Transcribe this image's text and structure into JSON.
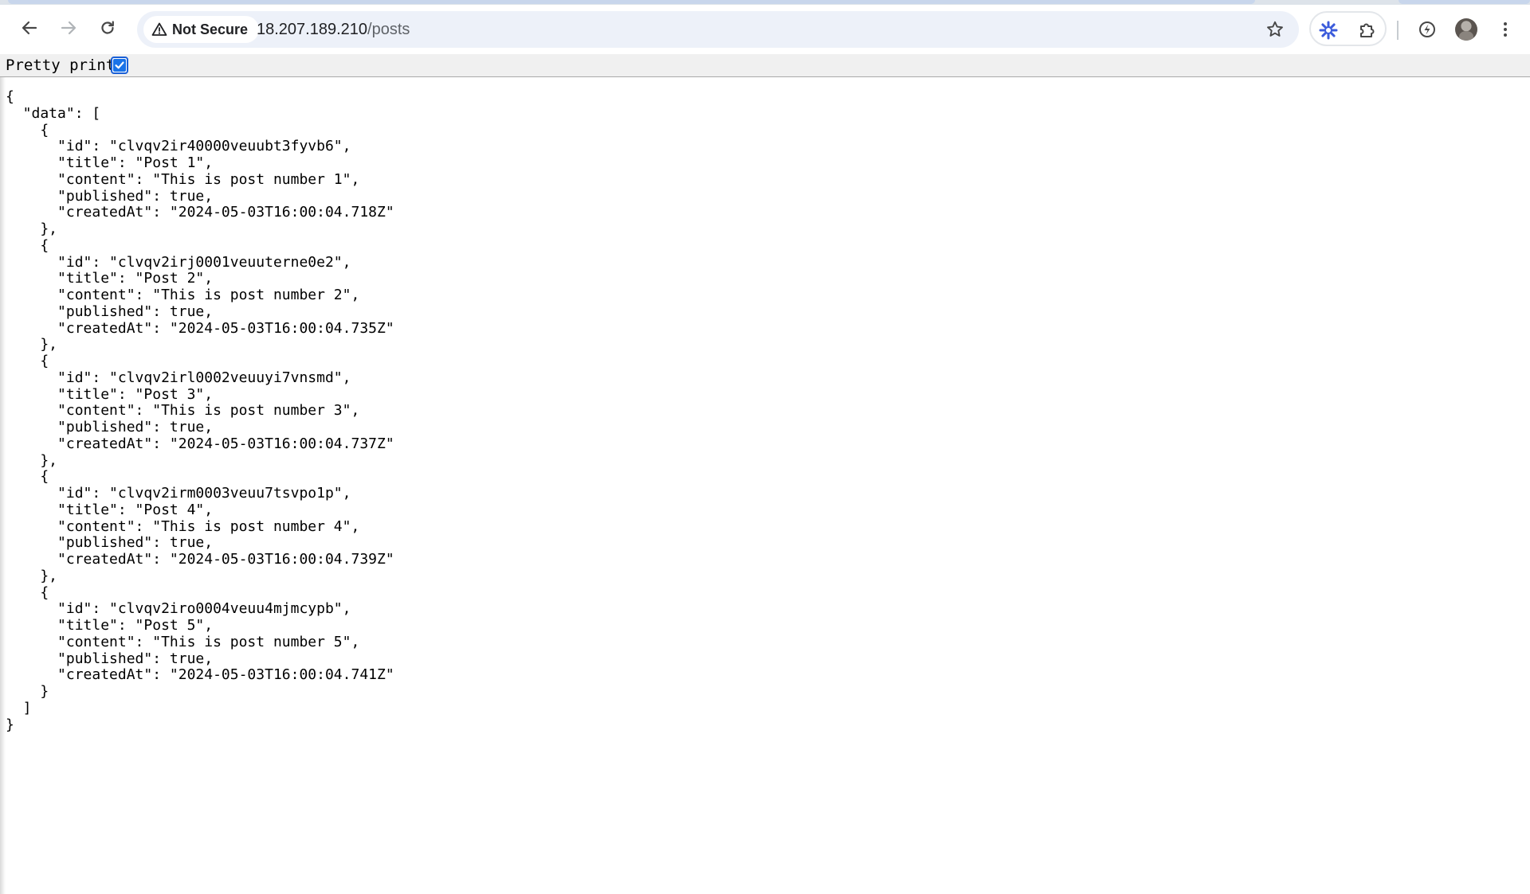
{
  "browser": {
    "security_label": "Not Secure",
    "url_host": "18.207.189.210",
    "url_path": "/posts"
  },
  "icons": {
    "back": "arrow-left-icon",
    "forward": "arrow-right-icon",
    "reload": "reload-icon",
    "security": "warning-triangle-icon",
    "bookmark": "star-icon",
    "extension_active": "asterisk-extension-icon",
    "extensions": "puzzle-icon",
    "performance": "performance-leaf-icon",
    "profile": "avatar",
    "menu": "kebab-menu-icon"
  },
  "colors": {
    "checkbox_accent": "#1a73e8",
    "omnibox_bg": "#edf1f9",
    "extension_icon": "#3b5bdb"
  },
  "pretty_print": {
    "label": "Pretty print",
    "checked": true
  },
  "json_lines": [
    "{",
    "  \"data\": [",
    "    {",
    "      \"id\": \"clvqv2ir40000veuubt3fyvb6\",",
    "      \"title\": \"Post 1\",",
    "      \"content\": \"This is post number 1\",",
    "      \"published\": true,",
    "      \"createdAt\": \"2024-05-03T16:00:04.718Z\"",
    "    },",
    "    {",
    "      \"id\": \"clvqv2irj0001veuuterne0e2\",",
    "      \"title\": \"Post 2\",",
    "      \"content\": \"This is post number 2\",",
    "      \"published\": true,",
    "      \"createdAt\": \"2024-05-03T16:00:04.735Z\"",
    "    },",
    "    {",
    "      \"id\": \"clvqv2irl0002veuuyi7vnsmd\",",
    "      \"title\": \"Post 3\",",
    "      \"content\": \"This is post number 3\",",
    "      \"published\": true,",
    "      \"createdAt\": \"2024-05-03T16:00:04.737Z\"",
    "    },",
    "    {",
    "      \"id\": \"clvqv2irm0003veuu7tsvpo1p\",",
    "      \"title\": \"Post 4\",",
    "      \"content\": \"This is post number 4\",",
    "      \"published\": true,",
    "      \"createdAt\": \"2024-05-03T16:00:04.739Z\"",
    "    },",
    "    {",
    "      \"id\": \"clvqv2iro0004veuu4mjmcypb\",",
    "      \"title\": \"Post 5\",",
    "      \"content\": \"This is post number 5\",",
    "      \"published\": true,",
    "      \"createdAt\": \"2024-05-03T16:00:04.741Z\"",
    "    }",
    "  ]",
    "}"
  ]
}
